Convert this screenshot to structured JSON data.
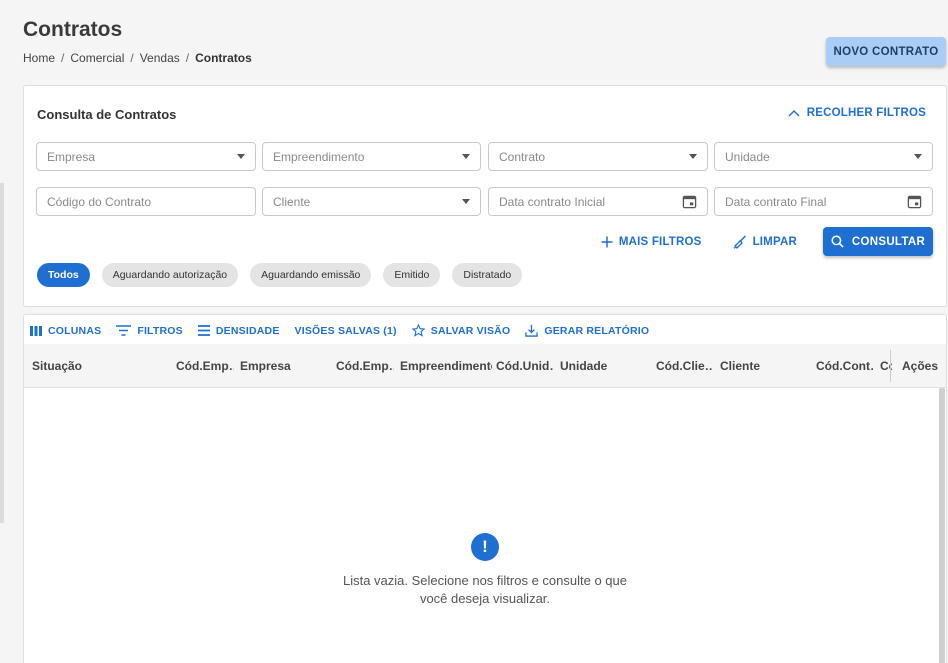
{
  "header": {
    "title": "Contratos",
    "breadcrumb": [
      "Home",
      "Comercial",
      "Vendas",
      "Contratos"
    ],
    "new_button": "NOVO CONTRATO"
  },
  "filters": {
    "title": "Consulta de Contratos",
    "collapse_label": "RECOLHER FILTROS",
    "fields": {
      "empresa": "Empresa",
      "empreendimento": "Empreendimento",
      "contrato": "Contrato",
      "unidade": "Unidade",
      "codigo": "Código do Contrato",
      "cliente": "Cliente",
      "data_inicial": "Data contrato Inicial",
      "data_final": "Data contrato Final"
    },
    "more_filters": "MAIS FILTROS",
    "clear": "LIMPAR",
    "search": "CONSULTAR",
    "chips": [
      "Todos",
      "Aguardando autorização",
      "Aguardando emissão",
      "Emitido",
      "Distratado"
    ],
    "active_chip": "Todos"
  },
  "grid": {
    "toolbar": {
      "columns": "COLUNAS",
      "filters": "FILTROS",
      "density": "DENSIDADE",
      "saved_views": "VISÕES SALVAS (1)",
      "save_view": "SALVAR VISÃO",
      "report": "GERAR RELATÓRIO"
    },
    "columns": [
      "Situação",
      "Cód.Emp…",
      "Empresa",
      "Cód.Emp…",
      "Empreendimento",
      "Cód.Unid…",
      "Unidade",
      "Cód.Clie…",
      "Cliente",
      "Cód.Cont…",
      "Co",
      "Ações"
    ],
    "empty_line1": "Lista vazia. Selecione nos filtros e consulte o que",
    "empty_line2": "você deseja visualizar.",
    "empty_icon": "!"
  },
  "colors": {
    "primary": "#1e6fd1",
    "primary_light": "#a9cdf5"
  }
}
